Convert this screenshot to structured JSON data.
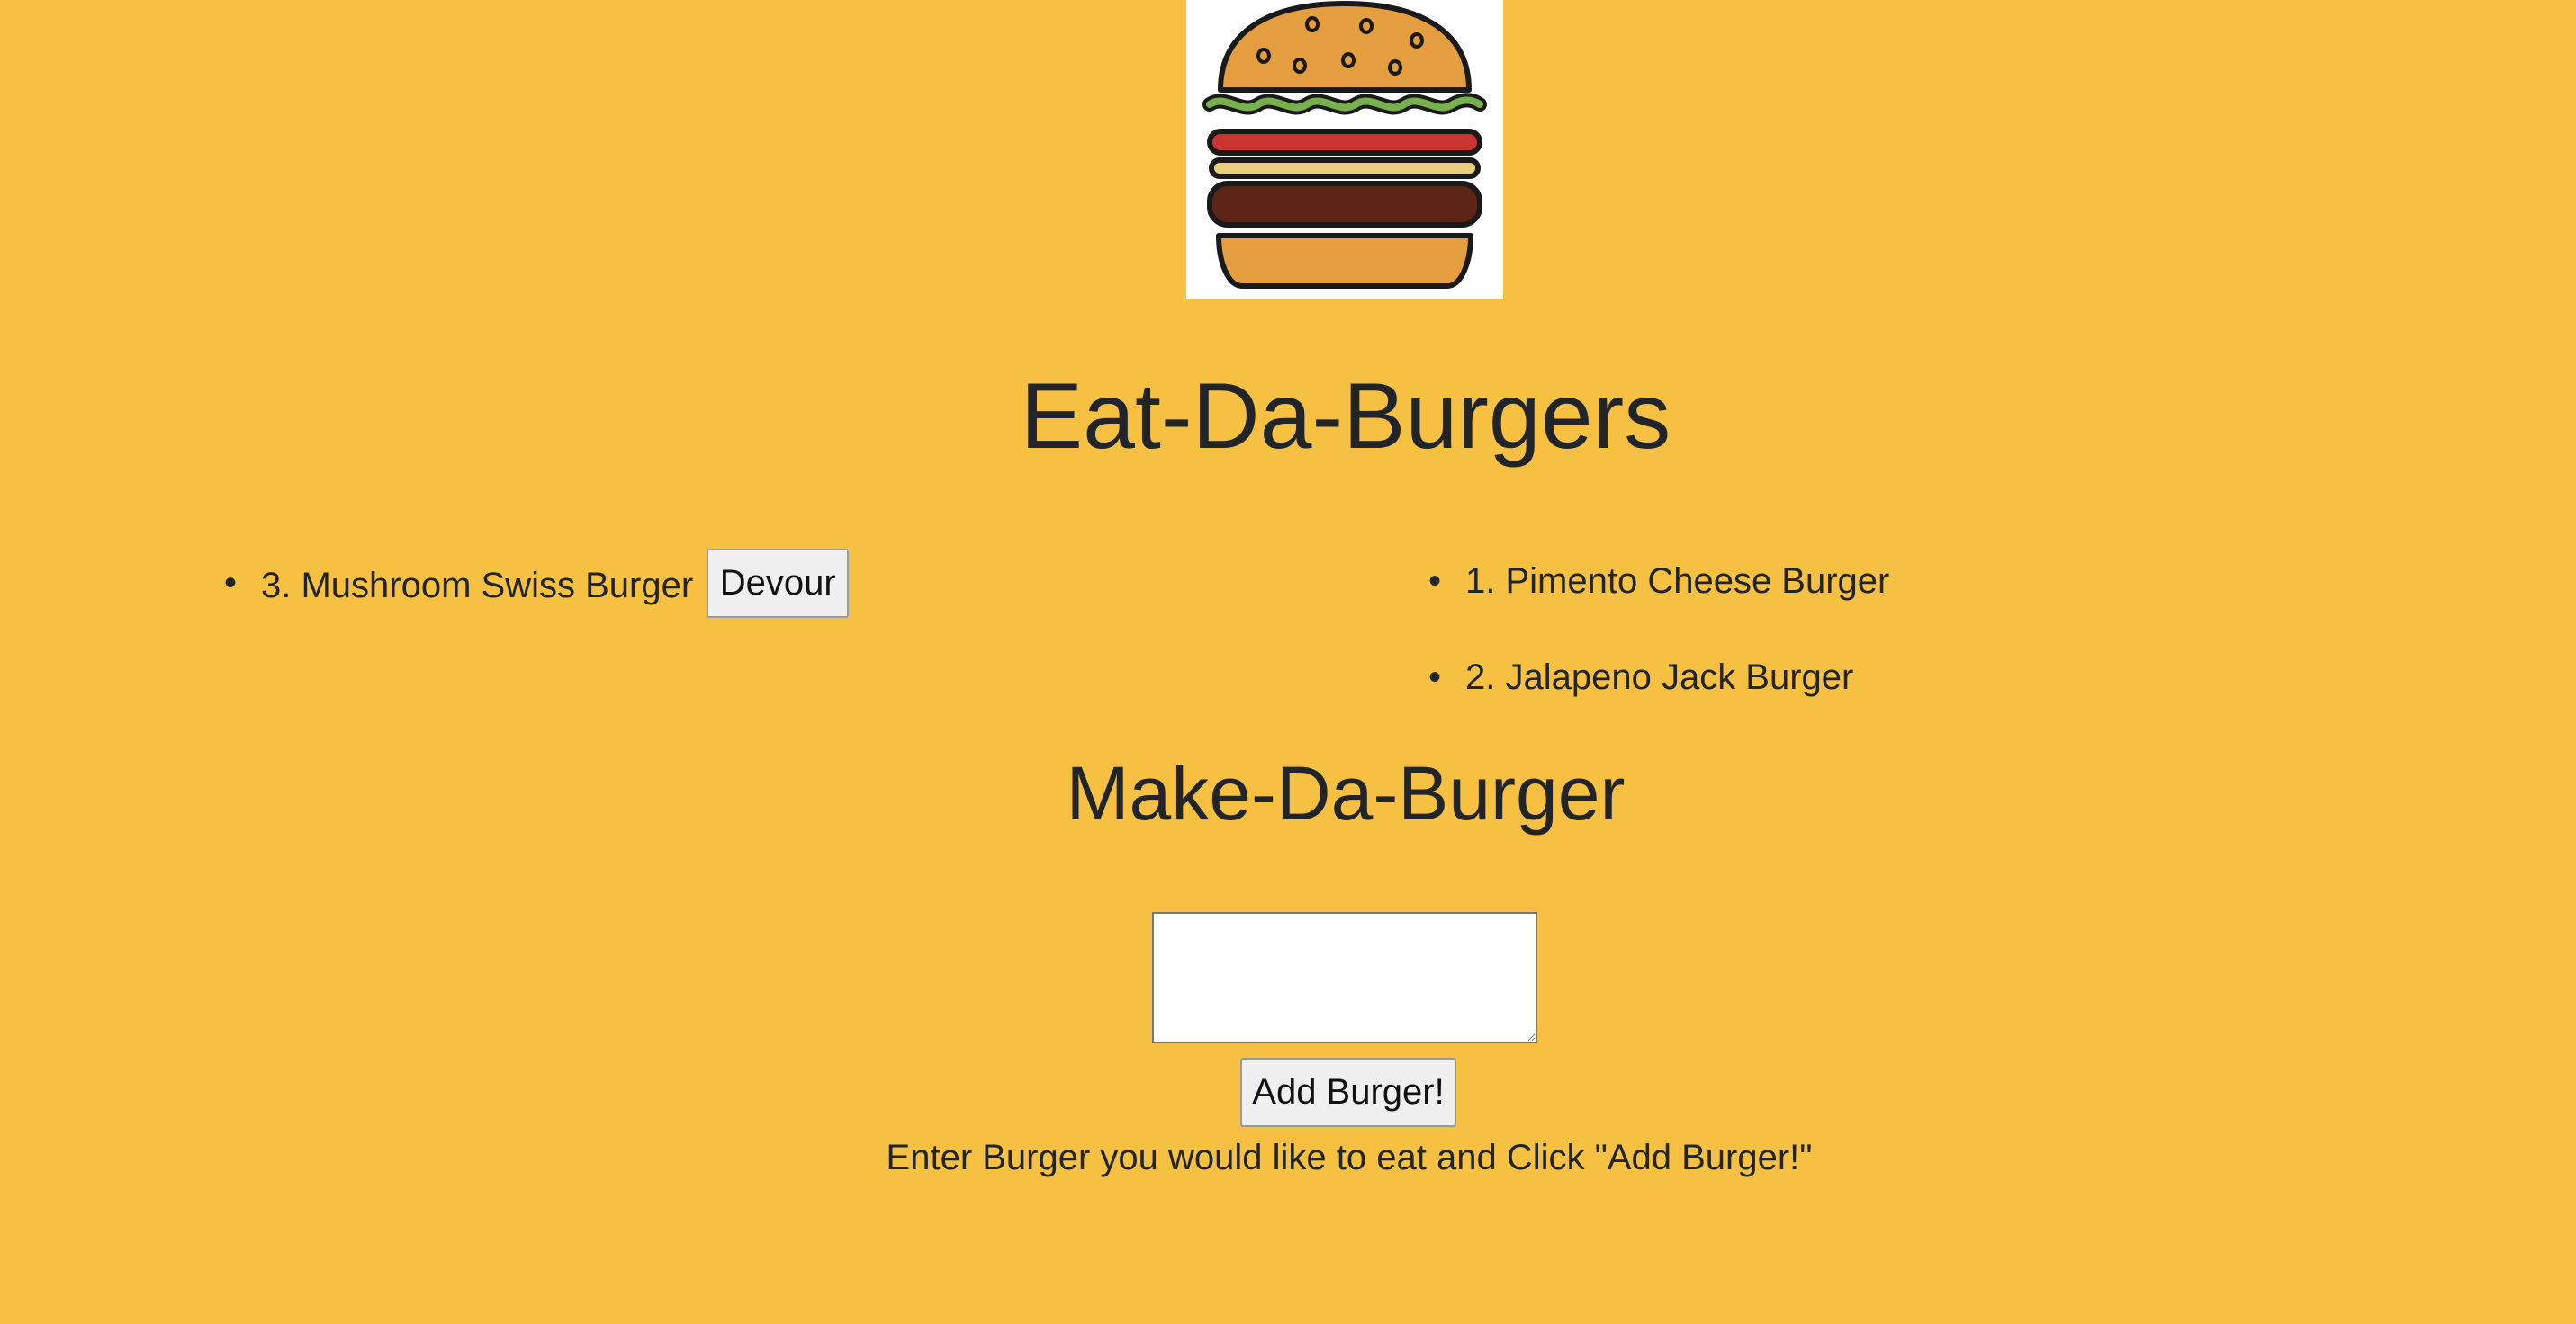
{
  "page": {
    "title": "Eat-Da-Burgers",
    "logo_alt": "burger-logo"
  },
  "uneaten": {
    "items": [
      {
        "label": "3. Mushroom Swiss Burger",
        "button_label": "Devour"
      }
    ]
  },
  "devoured": {
    "items": [
      {
        "label": "1. Pimento Cheese Burger"
      },
      {
        "label": "2. Jalapeno Jack Burger"
      }
    ]
  },
  "form": {
    "heading": "Make-Da-Burger",
    "input_value": "",
    "input_placeholder": "",
    "submit_label": "Add Burger!",
    "hint": "Enter Burger you would like to eat and Click \"Add Burger!\""
  },
  "colors": {
    "background": "#F6C142",
    "text": "#212529",
    "bun": "#E59E3F",
    "lettuce": "#78B04C",
    "tomato": "#C93531",
    "cheese": "#E8CF7A",
    "patty": "#5E2416"
  }
}
